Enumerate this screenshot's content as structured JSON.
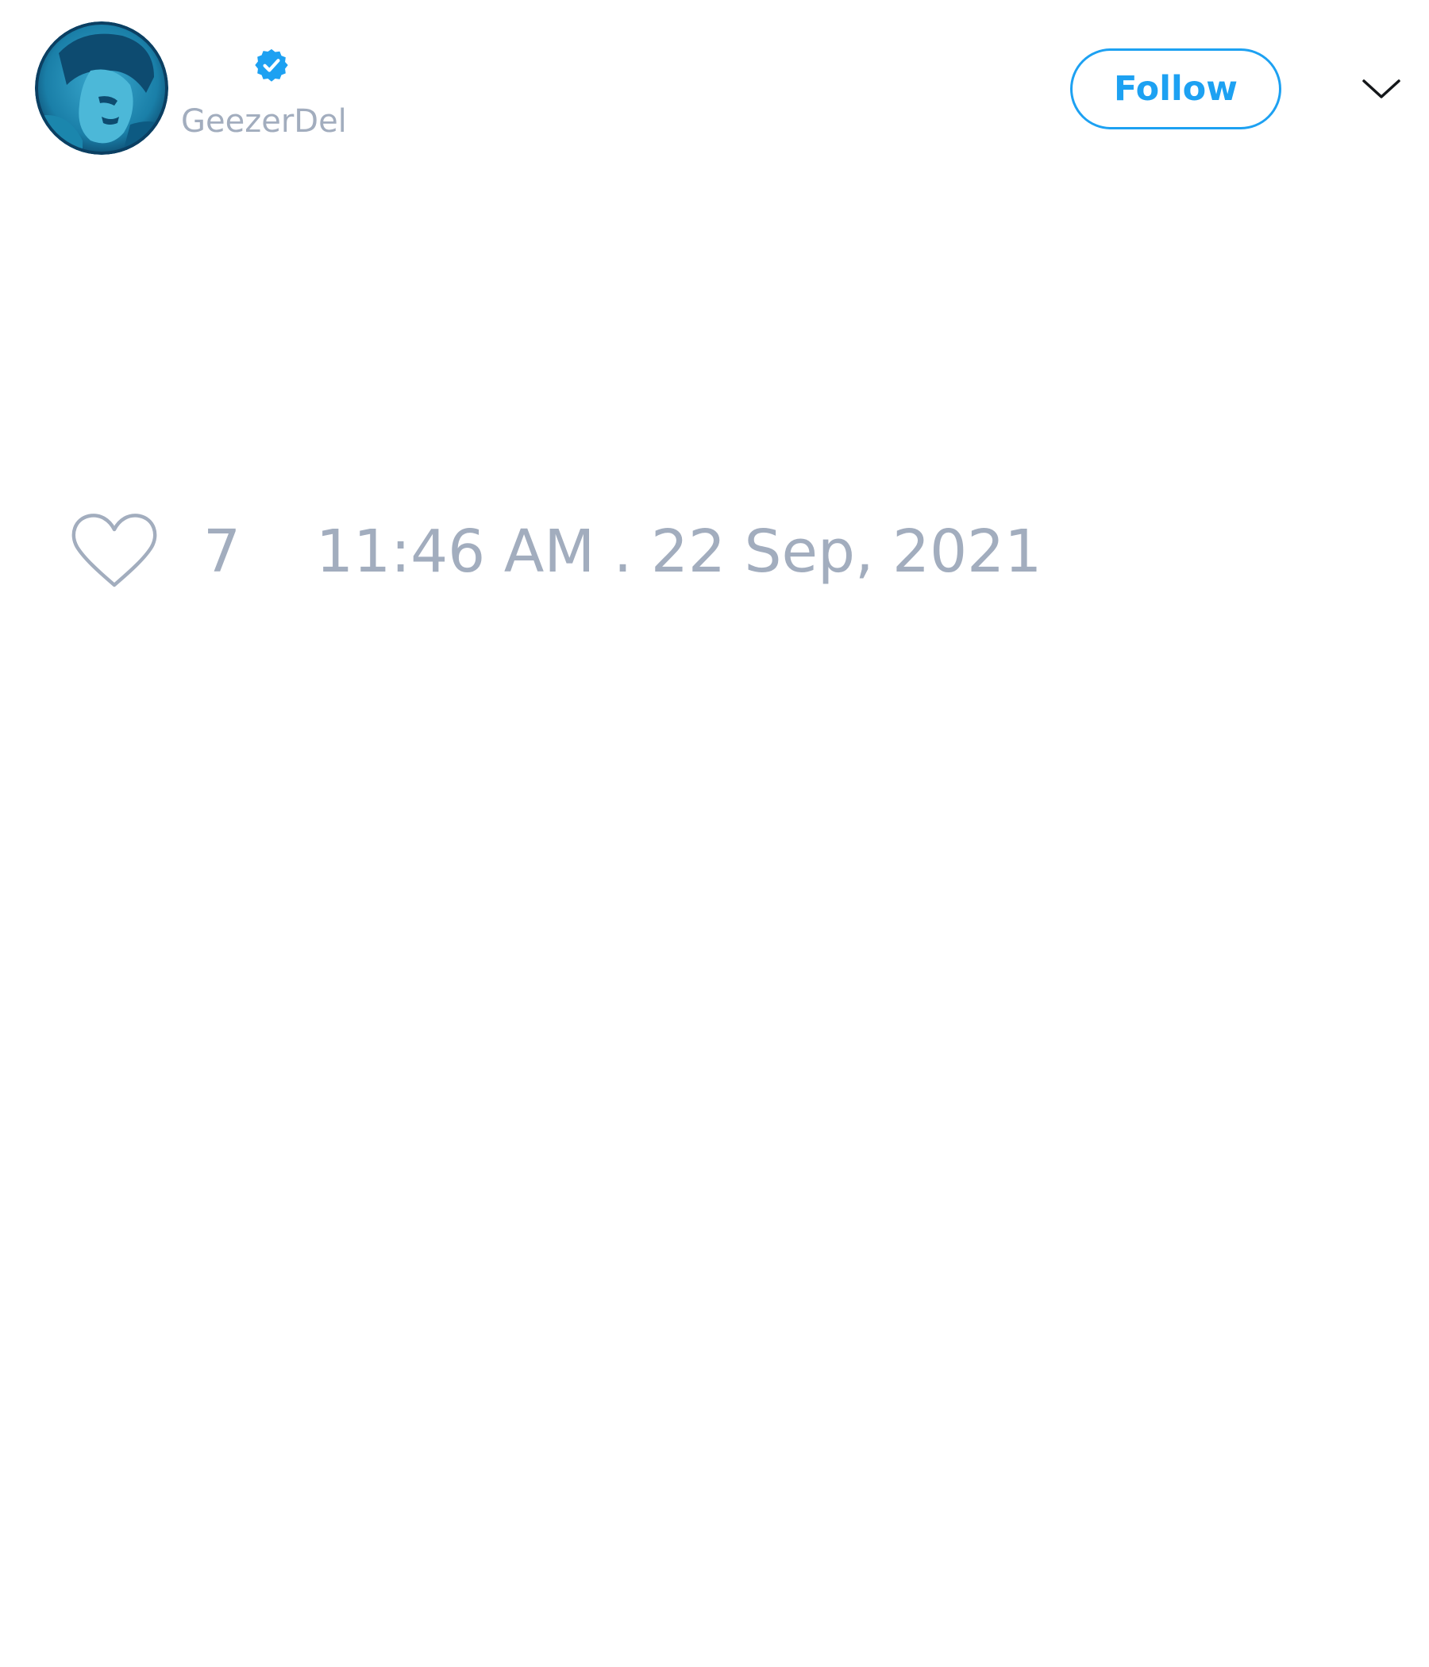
{
  "tweet": {
    "author": {
      "handle": "GeezerDel",
      "verified": true,
      "avatar": "profile-photo"
    },
    "actions": {
      "follow_label": "Follow",
      "more_icon": "chevron-down-icon"
    },
    "likes": {
      "icon": "heart-icon",
      "count": "7"
    },
    "timestamp": "11:46 AM . 22 Sep, 2021"
  },
  "colors": {
    "accent": "#1da1f2",
    "muted_text": "#a2adbe",
    "avatar_dark": "#0d4b70",
    "avatar_light": "#4cb8d8",
    "background": "#ffffff"
  }
}
